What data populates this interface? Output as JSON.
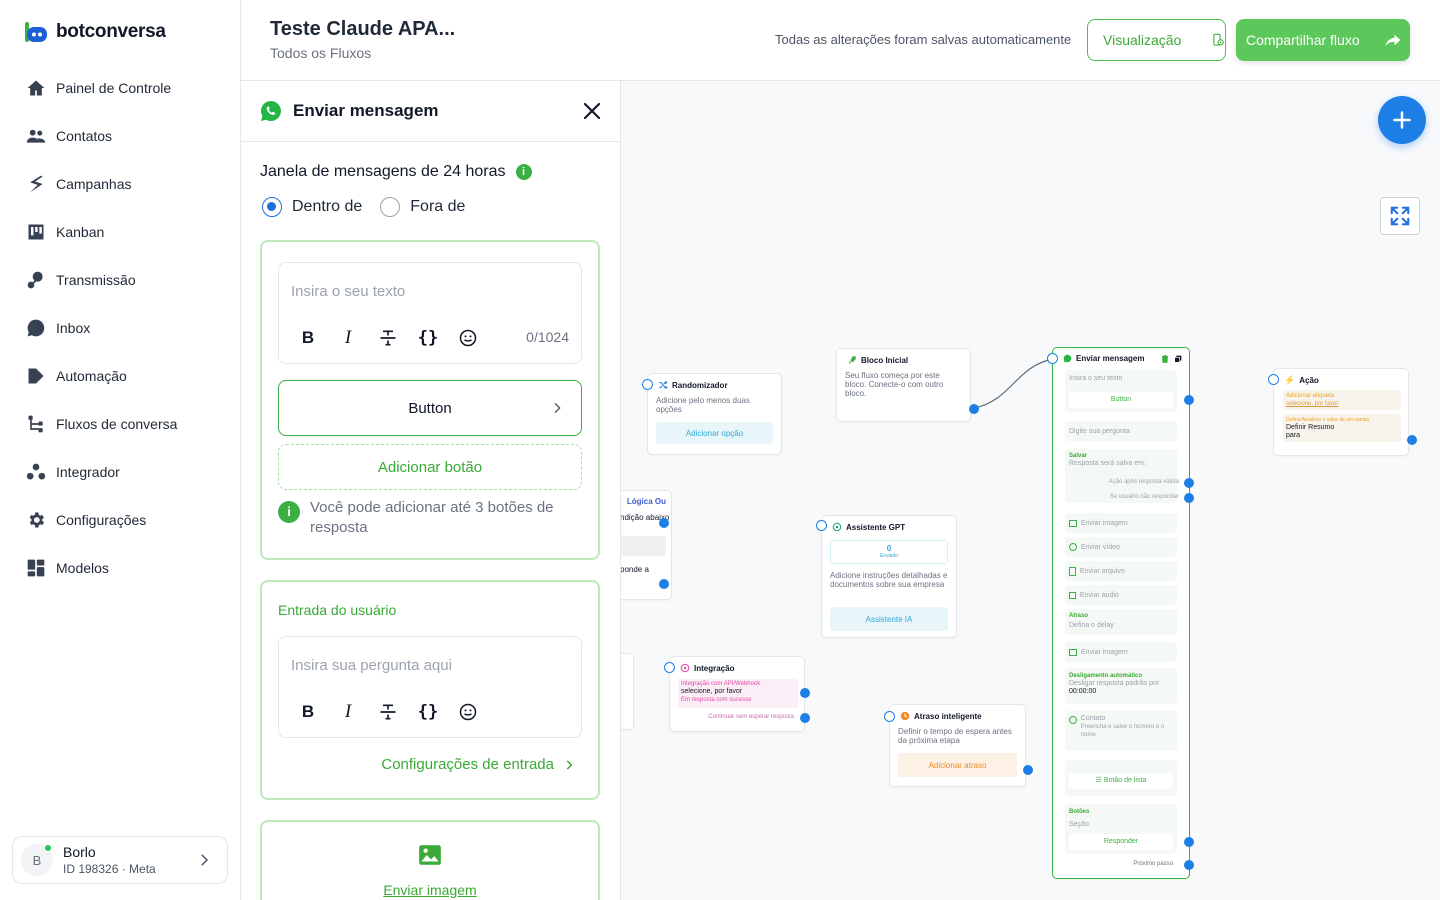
{
  "app": {
    "brand": "botconversa",
    "brand_color": "#3cb043",
    "accent_blue": "#1d7fe6"
  },
  "sidebar": {
    "items": [
      {
        "label": "Painel de Controle",
        "icon": "home-icon"
      },
      {
        "label": "Contatos",
        "icon": "users-icon"
      },
      {
        "label": "Campanhas",
        "icon": "campaign-icon"
      },
      {
        "label": "Kanban",
        "icon": "kanban-icon"
      },
      {
        "label": "Transmissão",
        "icon": "broadcast-icon"
      },
      {
        "label": "Inbox",
        "icon": "chat-bubble-icon"
      },
      {
        "label": "Automação",
        "icon": "automation-icon"
      },
      {
        "label": "Fluxos de conversa",
        "icon": "flow-icon"
      },
      {
        "label": "Integrador",
        "icon": "integrator-icon"
      },
      {
        "label": "Configurações",
        "icon": "gear-icon"
      },
      {
        "label": "Modelos",
        "icon": "templates-icon"
      }
    ],
    "user": {
      "initial": "B",
      "name": "Borlo",
      "id_text": "ID 198326 · Meta"
    }
  },
  "header": {
    "title": "Teste Claude APA...",
    "subtitle": "Todos os Fluxos",
    "autosave_text": "Todas as alterações foram salvas automaticamente",
    "view_button": "Visualização",
    "share_button": "Compartilhar fluxo"
  },
  "panel": {
    "title": "Enviar mensagem",
    "window_label": "Janela de mensagens de 24 horas",
    "radio_inside": "Dentro de",
    "radio_outside": "Fora de",
    "text_placeholder": "Insira o seu texto",
    "char_counter": "0/1024",
    "button_label": "Button",
    "add_button_label": "Adicionar botão",
    "buttons_hint": "Você pode adicionar até 3 botões de resposta",
    "user_input_label": "Entrada do usuário",
    "question_placeholder": "Insira sua pergunta aqui",
    "input_settings_link": "Configurações de entrada",
    "send_image_link": "Enviar imagem"
  },
  "canvas": {
    "nodes": {
      "randomizer": {
        "title": "Randomizador",
        "desc": "Adicione pelo menos duas opções",
        "action": "Adicionar opção"
      },
      "start": {
        "title": "Bloco Inicial",
        "desc": "Seu fluxo começa por este bloco. Conecte-o com outro bloco."
      },
      "logic": {
        "title": "Lógica Ou",
        "line1": "ndição abaixo",
        "line2": "ponde a"
      },
      "gpt": {
        "title": "Assistente GPT",
        "count": "0",
        "count_label": "Enviado",
        "desc": "Adicione instruções detalhadas e documentos sobre sua empresa",
        "action": "Assistente IA"
      },
      "integration": {
        "title": "Integração",
        "tag": "Integração com API/Webhook",
        "select": "selecione, por favor",
        "ok": "Em resposta com sucesso",
        "skip": "Continuar sem esperar resposta"
      },
      "delay": {
        "title": "Atraso inteligente",
        "desc": "Definir o tempo de espera antes da próxima etapa",
        "action": "Adicionar atraso"
      },
      "send": {
        "title": "Enviar mensagem",
        "text_ph": "Insira o seu texto",
        "button": "Button",
        "question_ph": "Digite sua pergunta",
        "save_title": "Salvar",
        "save_desc": "Resposta será salva em:",
        "valid": "Ação após resposta válida",
        "no_reply": "Se usuário não responder",
        "send_image": "Enviar imagem",
        "send_video": "Enviar vídeo",
        "send_file": "Enviar arquivo",
        "send_audio": "Enviar áudio",
        "delay_title": "Atraso",
        "delay_desc": "Defina o delay",
        "send_image2": "Enviar imagem",
        "auto_off_title": "Desligamento automático",
        "auto_off_desc": "Desligar resposta padrão por",
        "auto_off_time": "00:00:00",
        "contact_title": "Contato",
        "contact_desc": "Preencha e salve o número e o nome",
        "list_button": "Botão de lista",
        "buttons_title": "Botões",
        "section": "Seção",
        "reply": "Responder",
        "next_step": "Próximo passo"
      },
      "action": {
        "title": "Ação",
        "tag1": "Adicionar etiqueta",
        "tag1_val": "selecione, por favor",
        "tag2": "Definir/Atualizar o valor de um campo",
        "tag2_val1": "Definir Resumo",
        "tag2_val2": "para"
      }
    }
  }
}
